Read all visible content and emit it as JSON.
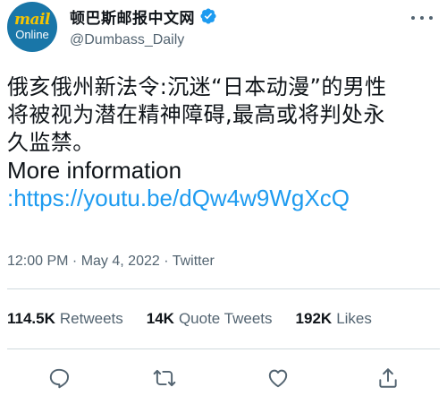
{
  "account": {
    "display_name": "顿巴斯邮报中文网",
    "handle": "@Dumbass_Daily",
    "avatar_top": "mail",
    "avatar_bottom": "Online",
    "verified": true
  },
  "tweet": {
    "line1": "俄亥俄州新法令:沉迷“日本动漫”的男性",
    "line2": "将被视为潜在精神障碍,最高或将判处永",
    "line3": "久监禁。",
    "line4": "More information",
    "link": ":https://youtu.be/dQw4w9WgXcQ"
  },
  "meta": {
    "text": "12:00 PM · May 4, 2022 · Twitter"
  },
  "stats": [
    {
      "value": "114.5K",
      "label": "Retweets"
    },
    {
      "value": "14K",
      "label": "Quote Tweets"
    },
    {
      "value": "192K",
      "label": "Likes"
    }
  ],
  "icons": {
    "reply": "reply-icon",
    "retweet": "retweet-icon",
    "like": "like-icon",
    "share": "share-icon",
    "verified": "verified-badge-icon",
    "more": "more-options-icon"
  },
  "colors": {
    "link": "#1d9bf0",
    "text": "#0f1419",
    "secondary": "#536471",
    "avatar_bg": "#1976a8",
    "avatar_logo": "#f5c400"
  }
}
